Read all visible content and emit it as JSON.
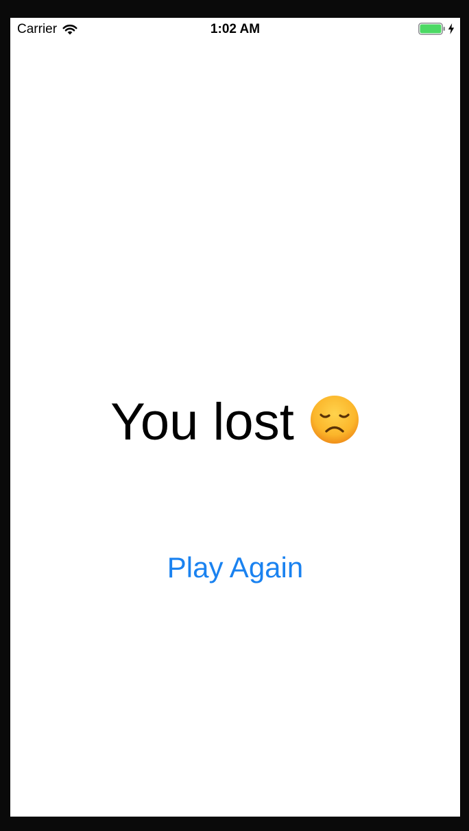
{
  "status_bar": {
    "carrier": "Carrier",
    "time": "1:02 AM",
    "wifi_icon": "wifi-icon",
    "battery_icon": "battery-icon",
    "charging_icon": "charging-bolt-icon",
    "battery_level": 1.0,
    "battery_color": "#4cd964"
  },
  "main": {
    "result_text": "You lost",
    "result_emoji": "sad-face-icon",
    "play_again_label": "Play Again",
    "accent_color": "#1a82f0"
  }
}
